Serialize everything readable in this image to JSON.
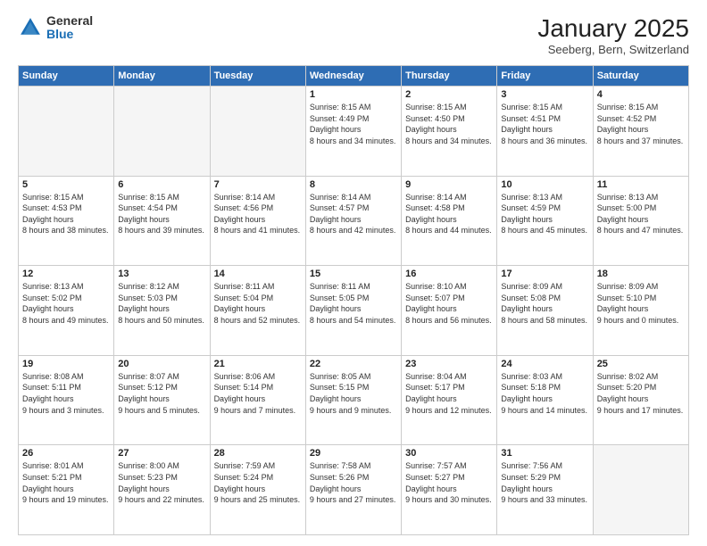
{
  "header": {
    "logo_general": "General",
    "logo_blue": "Blue",
    "month_title": "January 2025",
    "location": "Seeberg, Bern, Switzerland"
  },
  "weekdays": [
    "Sunday",
    "Monday",
    "Tuesday",
    "Wednesday",
    "Thursday",
    "Friday",
    "Saturday"
  ],
  "weeks": [
    [
      {
        "day": "",
        "empty": true
      },
      {
        "day": "",
        "empty": true
      },
      {
        "day": "",
        "empty": true
      },
      {
        "day": "1",
        "sunrise": "8:15 AM",
        "sunset": "4:49 PM",
        "daylight": "8 hours and 34 minutes."
      },
      {
        "day": "2",
        "sunrise": "8:15 AM",
        "sunset": "4:50 PM",
        "daylight": "8 hours and 34 minutes."
      },
      {
        "day": "3",
        "sunrise": "8:15 AM",
        "sunset": "4:51 PM",
        "daylight": "8 hours and 36 minutes."
      },
      {
        "day": "4",
        "sunrise": "8:15 AM",
        "sunset": "4:52 PM",
        "daylight": "8 hours and 37 minutes."
      }
    ],
    [
      {
        "day": "5",
        "sunrise": "8:15 AM",
        "sunset": "4:53 PM",
        "daylight": "8 hours and 38 minutes."
      },
      {
        "day": "6",
        "sunrise": "8:15 AM",
        "sunset": "4:54 PM",
        "daylight": "8 hours and 39 minutes."
      },
      {
        "day": "7",
        "sunrise": "8:14 AM",
        "sunset": "4:56 PM",
        "daylight": "8 hours and 41 minutes."
      },
      {
        "day": "8",
        "sunrise": "8:14 AM",
        "sunset": "4:57 PM",
        "daylight": "8 hours and 42 minutes."
      },
      {
        "day": "9",
        "sunrise": "8:14 AM",
        "sunset": "4:58 PM",
        "daylight": "8 hours and 44 minutes."
      },
      {
        "day": "10",
        "sunrise": "8:13 AM",
        "sunset": "4:59 PM",
        "daylight": "8 hours and 45 minutes."
      },
      {
        "day": "11",
        "sunrise": "8:13 AM",
        "sunset": "5:00 PM",
        "daylight": "8 hours and 47 minutes."
      }
    ],
    [
      {
        "day": "12",
        "sunrise": "8:13 AM",
        "sunset": "5:02 PM",
        "daylight": "8 hours and 49 minutes."
      },
      {
        "day": "13",
        "sunrise": "8:12 AM",
        "sunset": "5:03 PM",
        "daylight": "8 hours and 50 minutes."
      },
      {
        "day": "14",
        "sunrise": "8:11 AM",
        "sunset": "5:04 PM",
        "daylight": "8 hours and 52 minutes."
      },
      {
        "day": "15",
        "sunrise": "8:11 AM",
        "sunset": "5:05 PM",
        "daylight": "8 hours and 54 minutes."
      },
      {
        "day": "16",
        "sunrise": "8:10 AM",
        "sunset": "5:07 PM",
        "daylight": "8 hours and 56 minutes."
      },
      {
        "day": "17",
        "sunrise": "8:09 AM",
        "sunset": "5:08 PM",
        "daylight": "8 hours and 58 minutes."
      },
      {
        "day": "18",
        "sunrise": "8:09 AM",
        "sunset": "5:10 PM",
        "daylight": "9 hours and 0 minutes."
      }
    ],
    [
      {
        "day": "19",
        "sunrise": "8:08 AM",
        "sunset": "5:11 PM",
        "daylight": "9 hours and 3 minutes."
      },
      {
        "day": "20",
        "sunrise": "8:07 AM",
        "sunset": "5:12 PM",
        "daylight": "9 hours and 5 minutes."
      },
      {
        "day": "21",
        "sunrise": "8:06 AM",
        "sunset": "5:14 PM",
        "daylight": "9 hours and 7 minutes."
      },
      {
        "day": "22",
        "sunrise": "8:05 AM",
        "sunset": "5:15 PM",
        "daylight": "9 hours and 9 minutes."
      },
      {
        "day": "23",
        "sunrise": "8:04 AM",
        "sunset": "5:17 PM",
        "daylight": "9 hours and 12 minutes."
      },
      {
        "day": "24",
        "sunrise": "8:03 AM",
        "sunset": "5:18 PM",
        "daylight": "9 hours and 14 minutes."
      },
      {
        "day": "25",
        "sunrise": "8:02 AM",
        "sunset": "5:20 PM",
        "daylight": "9 hours and 17 minutes."
      }
    ],
    [
      {
        "day": "26",
        "sunrise": "8:01 AM",
        "sunset": "5:21 PM",
        "daylight": "9 hours and 19 minutes."
      },
      {
        "day": "27",
        "sunrise": "8:00 AM",
        "sunset": "5:23 PM",
        "daylight": "9 hours and 22 minutes."
      },
      {
        "day": "28",
        "sunrise": "7:59 AM",
        "sunset": "5:24 PM",
        "daylight": "9 hours and 25 minutes."
      },
      {
        "day": "29",
        "sunrise": "7:58 AM",
        "sunset": "5:26 PM",
        "daylight": "9 hours and 27 minutes."
      },
      {
        "day": "30",
        "sunrise": "7:57 AM",
        "sunset": "5:27 PM",
        "daylight": "9 hours and 30 minutes."
      },
      {
        "day": "31",
        "sunrise": "7:56 AM",
        "sunset": "5:29 PM",
        "daylight": "9 hours and 33 minutes."
      },
      {
        "day": "",
        "empty": true
      }
    ]
  ]
}
